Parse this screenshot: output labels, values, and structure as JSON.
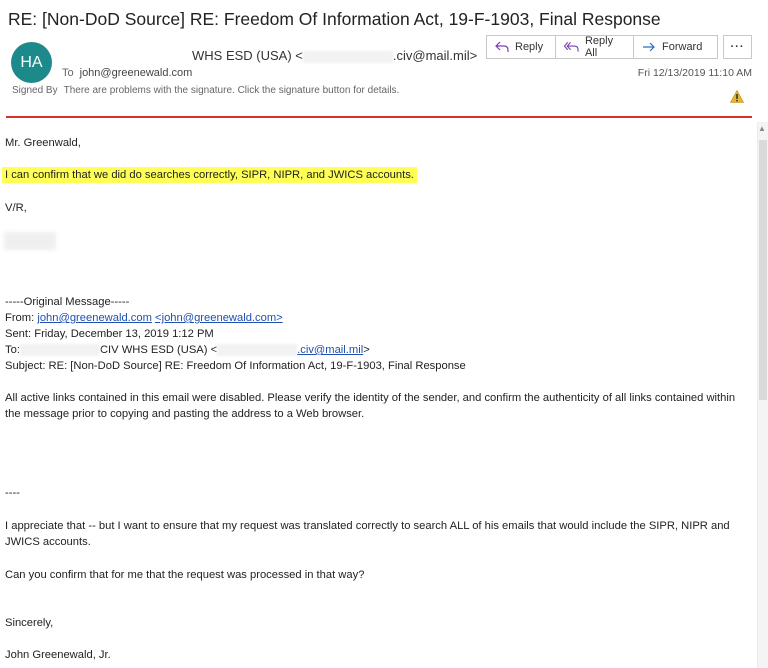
{
  "header": {
    "subject": "RE: [Non-DoD Source] RE: Freedom Of Information Act, 19-F-1903, Final Response",
    "avatar_initials": "HA",
    "sender_name": "WHS ESD (USA) <",
    "sender_email_suffix": ".civ@mail.mil>",
    "to_label": "To",
    "to_value": "john@greenewald.com",
    "signed_label": "Signed By",
    "signed_value": "There are problems with the signature. Click the signature button for details.",
    "date": "Fri 12/13/2019 11:10 AM"
  },
  "actions": {
    "reply": "Reply",
    "reply_all": "Reply All",
    "forward": "Forward",
    "more": "···"
  },
  "body": {
    "greeting": "Mr. Greenwald,",
    "highlight": "I can confirm that we did do searches correctly, SIPR, NIPR, and JWICS accounts.",
    "closing": "V/R,",
    "original_header": "-----Original Message-----",
    "from_label": "From: ",
    "from_link": "john@greenewald.com",
    "from_bracket_link": "<john@greenewald.com>",
    "sent": "Sent: Friday, December 13, 2019 1:12 PM",
    "to_label": "To:",
    "to_name": "CIV WHS ESD (USA) <",
    "to_link": ".civ@mail.mil",
    "to_close": ">",
    "orig_subject": "Subject: RE: [Non-DoD Source] RE: Freedom Of Information Act, 19-F-1903, Final Response",
    "disclaimer": "All active links contained in this email were disabled.  Please verify the identity of the sender, and confirm the authenticity of all links contained within the message prior to copying and pasting the address to a Web browser.",
    "dashes": "----",
    "para1": "I appreciate that -- but I want to ensure that my request was translated correctly to search ALL of his emails that would include the SIPR, NIPR and JWICS accounts.",
    "para2": "Can you confirm that for me that the request was processed in that way?",
    "sincerely": "Sincerely,",
    "signature": "John Greenewald, Jr."
  },
  "colors": {
    "avatar": "#1c8a8a",
    "highlight": "#ffff55",
    "divider": "#d9302c",
    "link": "#1f4fb3"
  }
}
